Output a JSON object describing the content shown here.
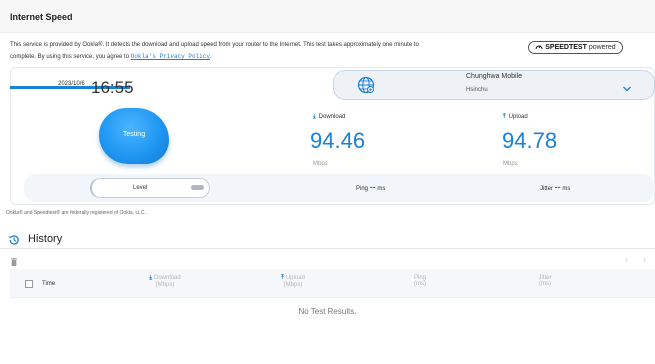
{
  "header": {
    "title": "Internet Speed"
  },
  "description": {
    "line1": "This service is provided by Ookla®. It detects the download and upload speed from your router to the Internet. This test takes approximately one minute to",
    "line2": "complete. By using this service, you agree to ",
    "link": "Ookla's Privacy Policy",
    "line2_end": "."
  },
  "badge": {
    "brand": "SPEEDTEST",
    "suffix": "powered"
  },
  "test": {
    "date": "2023/10/6",
    "time": "16:55",
    "isp_name": "Chunghwa Mobile",
    "isp_location": "Hsinchu",
    "gauge_status": "Testing",
    "download_label": "Download",
    "download_value": "94.46",
    "download_unit": "Mbps",
    "upload_label": "Upload",
    "upload_value": "94.78",
    "upload_unit": "Mbps",
    "level_label": "Level",
    "ping_label": "Ping",
    "ping_value": "--",
    "ping_unit": "ms",
    "jitter_label": "Jitter",
    "jitter_value": "--",
    "jitter_unit": "ms"
  },
  "legal": "Ookla® and Speedtest® are federally registered of Ookla, LLC.",
  "history": {
    "title": "History",
    "columns": {
      "time": "Time",
      "download": "Download",
      "download_unit": "(Mbps)",
      "upload": "Upload",
      "upload_unit": "(Mbps)",
      "ping": "Ping",
      "ping_unit": "(ms)",
      "jitter": "Jitter",
      "jitter_unit": "(ms)"
    },
    "empty_message": "No Test Results.",
    "prev": "‹",
    "next": "›"
  },
  "icons": {
    "globe": "globe-icon",
    "chevron": "chevron-down-icon",
    "history": "history-icon",
    "trash": "trash-icon",
    "download_arrow": "arrow-down-icon",
    "upload_arrow": "arrow-up-icon"
  },
  "colors": {
    "accent": "#1a7fd6",
    "gauge": "#1f97f2"
  }
}
